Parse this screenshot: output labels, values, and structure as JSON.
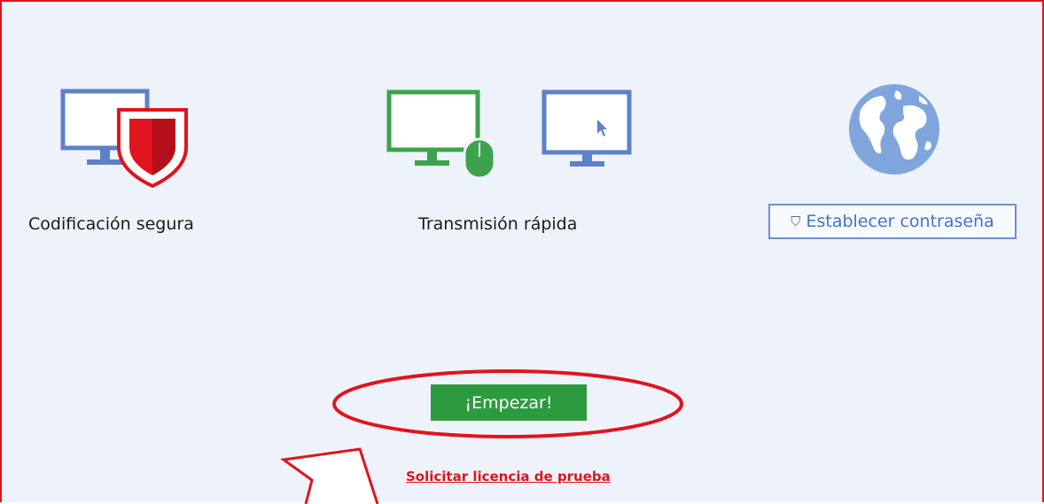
{
  "features": {
    "secure_encoding_label": "Codificación segura",
    "fast_transmission_label": "Transmisión rápida",
    "set_password_label": "Establecer contraseña"
  },
  "actions": {
    "start_label": "¡Empezar!",
    "trial_link_label": "Solicitar licencia de prueba"
  },
  "colors": {
    "frame_border": "#e0141e",
    "background": "#eef3fb",
    "monitor_blue": "#5b82c9",
    "monitor_green": "#3ca34d",
    "shield_red": "#e0141e",
    "globe_blue": "#7fa5dc",
    "start_button": "#2e9a3f"
  },
  "icons": [
    "monitor-shield-icon",
    "monitor-mouse-icon",
    "monitor-cursor-icon",
    "globe-icon",
    "shield-icon"
  ]
}
